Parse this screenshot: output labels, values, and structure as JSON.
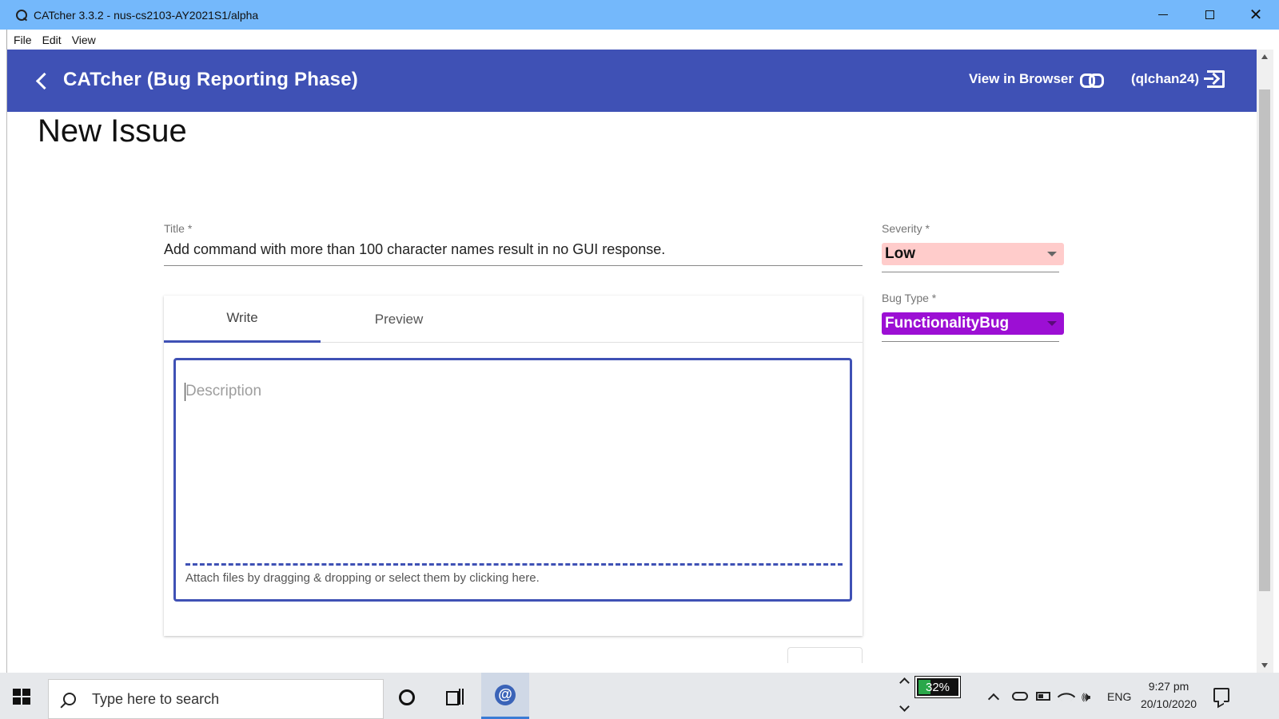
{
  "window": {
    "title": "CATcher 3.3.2 - nus-cs2103-AY2021S1/alpha"
  },
  "menu": [
    "File",
    "Edit",
    "View"
  ],
  "toolbar": {
    "app_title": "CATcher  (Bug Reporting Phase)",
    "view_in_browser": "View in Browser",
    "user": "(qlchan24)",
    "color": "#3f51b5"
  },
  "page": {
    "heading": "New Issue"
  },
  "form": {
    "title_label": "Title *",
    "title_value": "Add command with more than 100 character names result in no GUI response.",
    "tabs": [
      {
        "label": "Write",
        "active": true
      },
      {
        "label": "Preview",
        "active": false
      }
    ],
    "description_placeholder": "Description",
    "attach_hint": "Attach files by dragging & dropping or select them by clicking here.",
    "severity": {
      "label": "Severity *",
      "value": "Low",
      "background": "#ffcccb",
      "text_color": "#111111"
    },
    "bug_type": {
      "label": "Bug Type *",
      "value": "FunctionalityBug",
      "background": "#9c0fd4",
      "text_color": "#ffffff"
    }
  },
  "taskbar": {
    "search_placeholder": "Type here to search",
    "battery_percent": 32,
    "battery_text": "32%",
    "language": "ENG",
    "time": "9:27 pm",
    "date": "20/10/2020"
  }
}
